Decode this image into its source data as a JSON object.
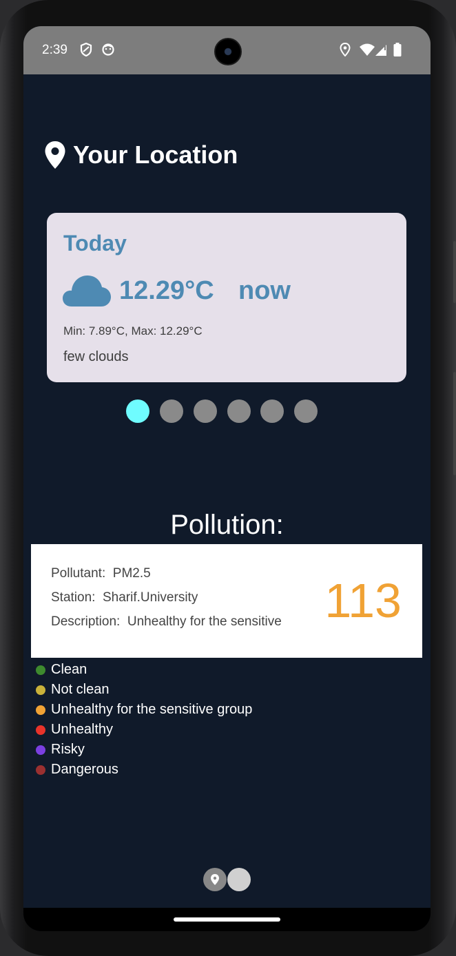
{
  "status_bar": {
    "time": "2:39",
    "left_icons": [
      "shield-icon",
      "face-icon"
    ],
    "right_icons": [
      "location-icon",
      "wifi-icon",
      "signal-icon",
      "battery-icon"
    ]
  },
  "header": {
    "title": "Your Location",
    "icon": "location-pin-icon"
  },
  "weather_card": {
    "day": "Today",
    "icon": "cloud-icon",
    "temperature": "12.29°C",
    "time_label": "now",
    "min_max": "Min: 7.89°C, Max: 12.29°C",
    "description": "few clouds"
  },
  "pager": {
    "count": 6,
    "active_index": 0
  },
  "pollution": {
    "title": "Pollution:",
    "pollutant_label": "Pollutant:",
    "pollutant_value": "PM2.5",
    "station_label": "Station:",
    "station_value": "Sharif.University",
    "description_label": "Description:",
    "description_value": "Unhealthy for the sensitive",
    "aqi": "113",
    "aqi_color": "#f0a235"
  },
  "legend": [
    {
      "label": "Clean",
      "color": "#3e8a2e"
    },
    {
      "label": "Not clean",
      "color": "#c9b13a"
    },
    {
      "label": "Unhealthy for the sensitive group",
      "color": "#f0a235"
    },
    {
      "label": "Unhealthy",
      "color": "#e8332a"
    },
    {
      "label": "Risky",
      "color": "#7b3fe0"
    },
    {
      "label": "Dangerous",
      "color": "#9a3030"
    }
  ],
  "bottom_nav": {
    "items": [
      "location-icon",
      "other"
    ]
  },
  "colors": {
    "background": "#101a2a",
    "accent": "#4e8ab3",
    "card": "#e6e0ea",
    "active_dot": "#6ffcff"
  }
}
